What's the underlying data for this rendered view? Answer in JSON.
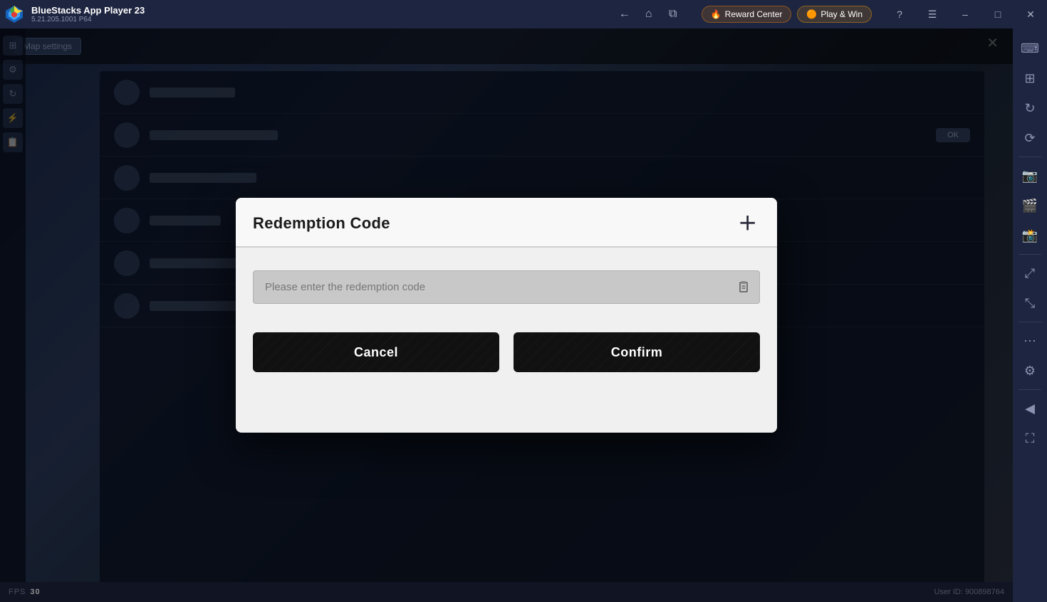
{
  "titlebar": {
    "app_name": "BlueStacks App Player 23",
    "app_version": "5.21.205.1001 P64",
    "reward_center_label": "Reward Center",
    "play_win_label": "Play & Win",
    "nav": {
      "back": "←",
      "home": "⌂",
      "copy": "⧉"
    },
    "window_controls": {
      "help": "?",
      "menu": "☰",
      "minimize": "─",
      "maximize": "☐",
      "close": "✕"
    }
  },
  "dialog": {
    "title": "Redemption Code",
    "close_label": "✕",
    "input_placeholder": "Please enter the redemption code",
    "cancel_label": "Cancel",
    "confirm_label": "Confirm"
  },
  "bottombar": {
    "fps_label": "FPS",
    "fps_value": "30",
    "user_id_label": "User ID: 900898764"
  },
  "sidebar": {
    "icons": [
      {
        "name": "keyboard-icon",
        "symbol": "⌨"
      },
      {
        "name": "apps-icon",
        "symbol": "⊞"
      },
      {
        "name": "rotate-icon",
        "symbol": "↻"
      },
      {
        "name": "refresh-icon",
        "symbol": "⟳"
      },
      {
        "name": "screenshot-icon",
        "symbol": "📷"
      },
      {
        "name": "video-icon",
        "symbol": "🎥"
      },
      {
        "name": "camera-icon",
        "symbol": "📸"
      },
      {
        "name": "settings-icon",
        "symbol": "⚙"
      },
      {
        "name": "expand-icon",
        "symbol": "⤢"
      },
      {
        "name": "more-icon",
        "symbol": "⋯"
      },
      {
        "name": "settings2-icon",
        "symbol": "⚙"
      },
      {
        "name": "arrow-left-icon",
        "symbol": "←"
      },
      {
        "name": "fullscreen-icon",
        "symbol": "⛶"
      }
    ]
  }
}
